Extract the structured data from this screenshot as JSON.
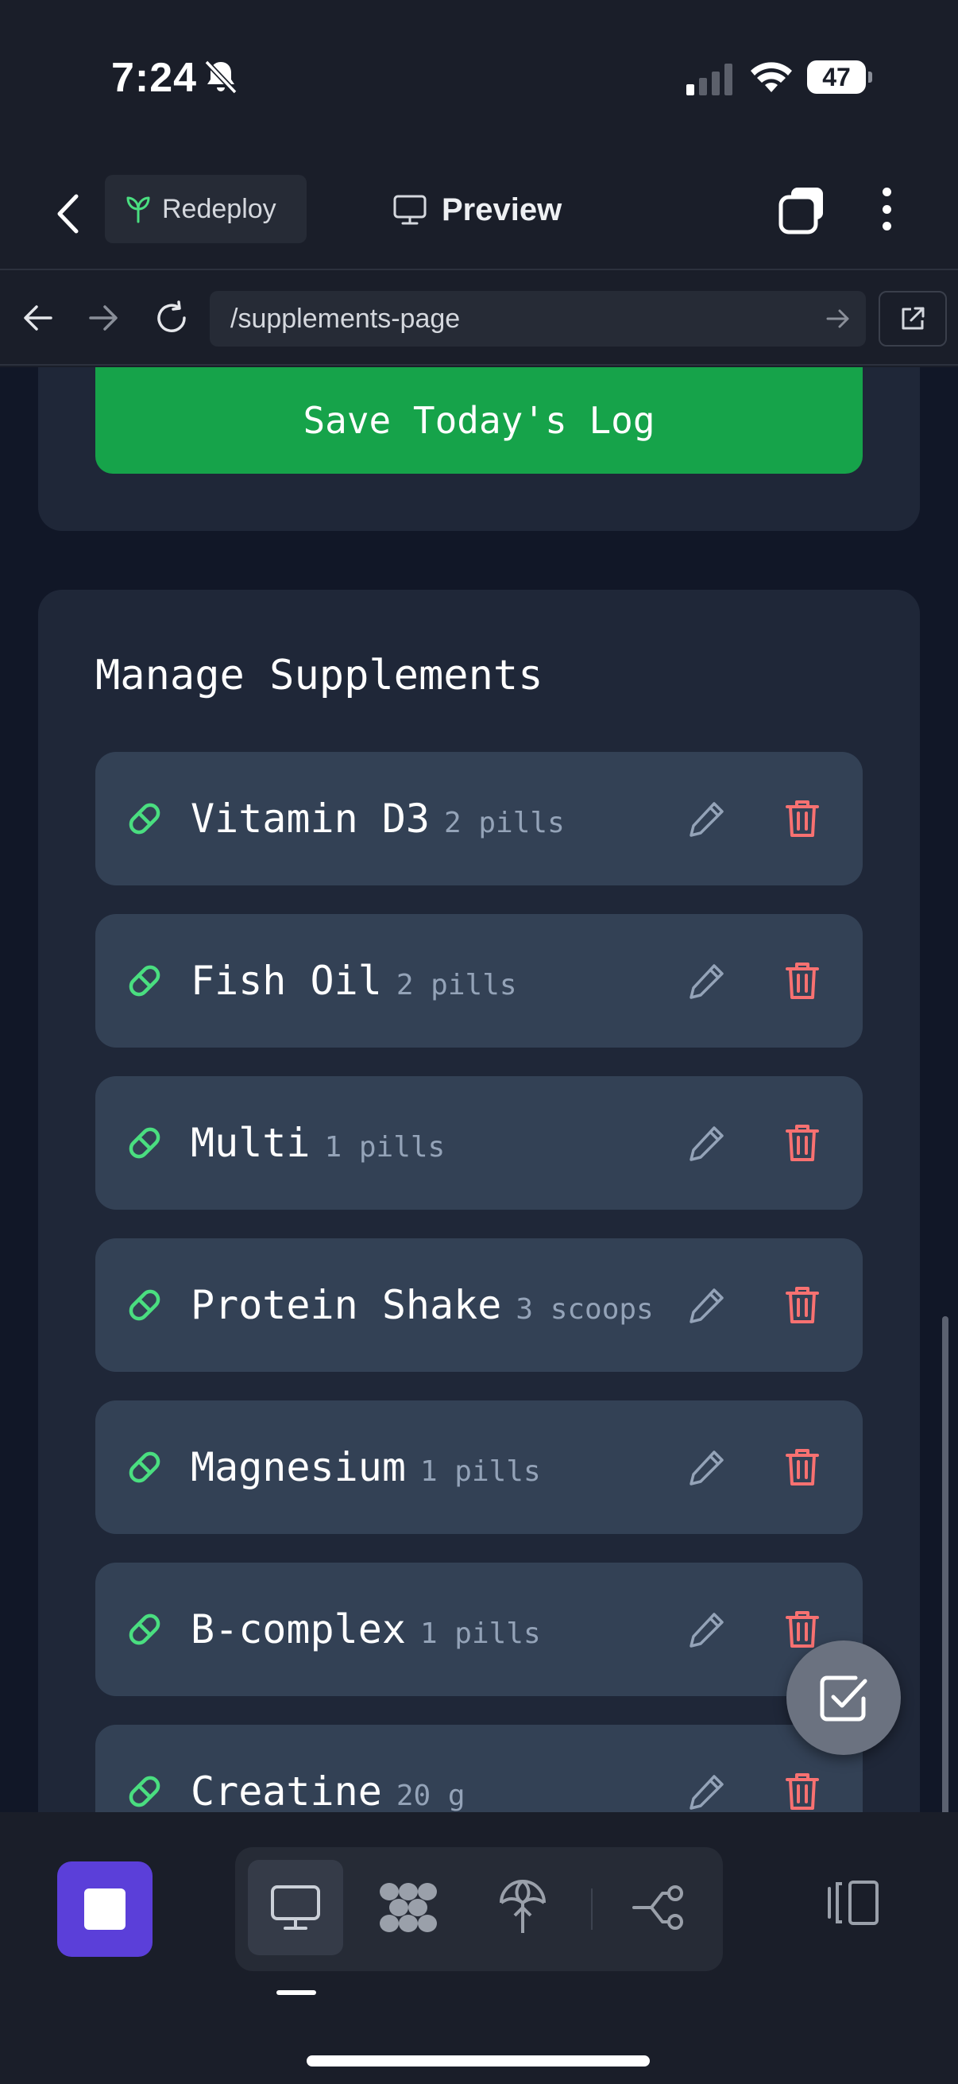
{
  "status_bar": {
    "time": "7:24",
    "battery": "47"
  },
  "header": {
    "redeploy_label": "Redeploy",
    "preview_label": "Preview"
  },
  "url_bar": {
    "url": "/supplements-page"
  },
  "main": {
    "save_label": "Save Today's Log",
    "manage_title": "Manage Supplements",
    "supplements": [
      {
        "name": "Vitamin D3",
        "dose": "2 pills"
      },
      {
        "name": "Fish Oil",
        "dose": "2 pills"
      },
      {
        "name": "Multi",
        "dose": "1 pills"
      },
      {
        "name": "Protein Shake",
        "dose": "3 scoops"
      },
      {
        "name": "Magnesium",
        "dose": "1 pills"
      },
      {
        "name": "B-complex",
        "dose": "1 pills"
      },
      {
        "name": "Creatine",
        "dose": "20 g"
      }
    ]
  },
  "colors": {
    "accent_green": "#16a34a",
    "pill_icon": "#4ade80",
    "delete_red": "#f87171",
    "stop_purple": "#5b3fd9"
  },
  "icons": {
    "status": [
      "bell-slash-icon",
      "signal-icon",
      "wifi-icon",
      "battery-icon"
    ],
    "header": [
      "chevron-left-icon",
      "sprout-icon",
      "monitor-icon",
      "tabs-icon",
      "more-vertical-icon"
    ],
    "url_bar": [
      "arrow-left-icon",
      "arrow-right-icon",
      "reload-icon",
      "arrow-right-icon",
      "external-link-icon"
    ],
    "item": [
      "pill-icon",
      "pencil-icon",
      "trash-icon"
    ],
    "toolbar": [
      "stop-icon",
      "monitor-icon",
      "database-icon",
      "deploy-icon",
      "workflow-icon",
      "panel-icon"
    ]
  }
}
